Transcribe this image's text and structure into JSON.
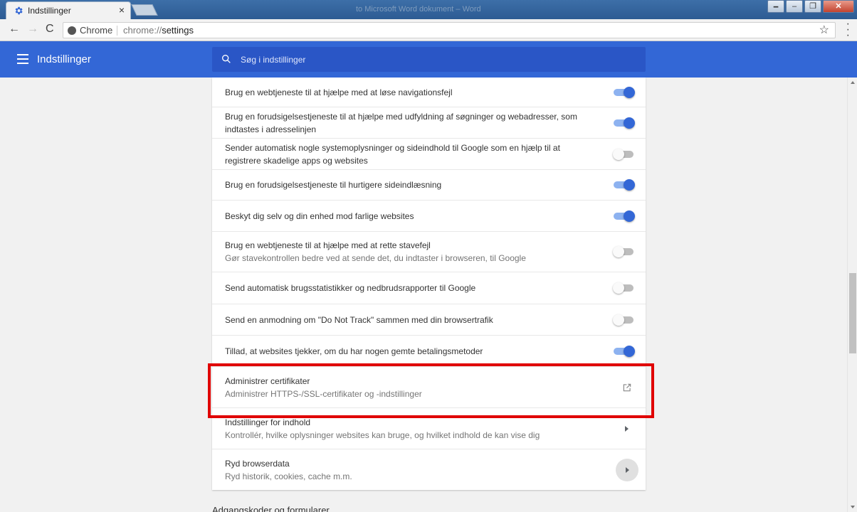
{
  "browser": {
    "tab_title": "Indstillinger",
    "tab_close": "×",
    "window_title": "to Microsoft Word dokument – Word",
    "window_buttons": [
      "🗕",
      "–",
      "❐",
      "✕"
    ],
    "site_label": "Chrome",
    "url_scheme": "chrome://",
    "url_path": "settings",
    "back": "←",
    "forward": "→",
    "reload": "C",
    "star": "☆"
  },
  "header": {
    "title": "Indstillinger",
    "search_placeholder": "Søg i indstillinger",
    "accent_color": "#3367d6"
  },
  "settings": {
    "rows": [
      {
        "label": "Brug en webtjeneste til at hjælpe med at løse navigationsfejl",
        "sub": "",
        "control": "toggle",
        "on": true
      },
      {
        "label": "Brug en forudsigelsestjeneste til at hjælpe med udfyldning af søgninger og webadresser, som indtastes i adresselinjen",
        "sub": "",
        "control": "toggle",
        "on": true
      },
      {
        "label": "Sender automatisk nogle systemoplysninger og sideindhold til Google som en hjælp til at registrere skadelige apps og websites",
        "sub": "",
        "control": "toggle",
        "on": false
      },
      {
        "label": "Brug en forudsigelsestjeneste til hurtigere sideindlæsning",
        "sub": "",
        "control": "toggle",
        "on": true
      },
      {
        "label": "Beskyt dig selv og din enhed mod farlige websites",
        "sub": "",
        "control": "toggle",
        "on": true
      },
      {
        "label": "Brug en webtjeneste til at hjælpe med at rette stavefejl",
        "sub": "Gør stavekontrollen bedre ved at sende det, du indtaster i browseren, til Google",
        "control": "toggle",
        "on": false
      },
      {
        "label": "Send automatisk brugsstatistikker og nedbrudsrapporter til Google",
        "sub": "",
        "control": "toggle",
        "on": false
      },
      {
        "label": "Send en anmodning om \"Do Not Track\" sammen med din browsertrafik",
        "sub": "",
        "control": "toggle",
        "on": false
      },
      {
        "label": "Tillad, at websites tjekker, om du har nogen gemte betalingsmetoder",
        "sub": "",
        "control": "toggle",
        "on": true
      },
      {
        "label": "Administrer certifikater",
        "sub": "Administrer HTTPS-/SSL-certifikater og -indstillinger",
        "control": "external-link-icon"
      },
      {
        "label": "Indstillinger for indhold",
        "sub": "Kontrollér, hvilke oplysninger websites kan bruge, og hvilket indhold de kan vise dig",
        "control": "arrow"
      },
      {
        "label": "Ryd browserdata",
        "sub": "Ryd historik, cookies, cache m.m.",
        "control": "arrow-circle"
      }
    ],
    "next_section": "Adgangskoder og formularer"
  },
  "highlight_color": "#e00000"
}
